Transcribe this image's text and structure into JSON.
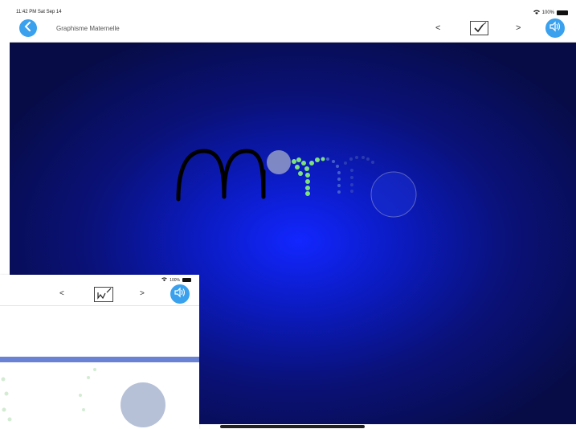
{
  "status_bar": {
    "time": "11:42 PM  Sat Sep 14",
    "battery": "100%"
  },
  "nav": {
    "title": "Graphisme Maternelle",
    "prev_label": "<",
    "next_label": ">"
  },
  "overlay": {
    "battery": "100%",
    "prev_label": "<",
    "next_label": ">"
  },
  "icons": {
    "back": "chevron-left-icon",
    "validate": "check-pen-icon",
    "sound": "speaker-icon"
  },
  "colors": {
    "accent": "#3aa1ee",
    "canvas_center": "#1226ff",
    "canvas_edge": "#070c46",
    "trace_done": "#000000",
    "trace_active": "#7ee07e",
    "overlay_bar": "#6a82d4"
  },
  "activity": {
    "letters_traced": "mm",
    "letters_remaining": "m"
  }
}
